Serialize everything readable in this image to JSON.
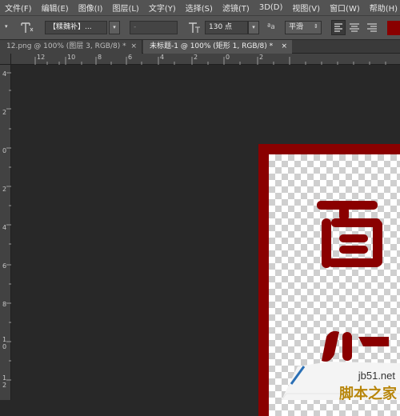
{
  "menu": [
    "文件(F)",
    "编辑(E)",
    "图像(I)",
    "图层(L)",
    "文字(Y)",
    "选择(S)",
    "滤镜(T)",
    "3D(D)",
    "视图(V)",
    "窗口(W)",
    "帮助(H)"
  ],
  "options": {
    "font_family": "【糅魏补】...",
    "font_style": "-",
    "font_size": "130 点",
    "aa_label": "ªa",
    "antialias": "平滑"
  },
  "tabs": [
    {
      "label": "12.png @ 100% (图层 3, RGB/8) *",
      "close": "×"
    },
    {
      "label": "未标题-1 @ 100% (矩形 1, RGB/8) *",
      "close": "×"
    }
  ],
  "ruler_h": [
    "12",
    "10",
    "8",
    "6",
    "4",
    "2",
    "0",
    "2"
  ],
  "ruler_v": [
    "4",
    "2",
    "0",
    "2",
    "4",
    "6",
    "8",
    "1",
    "0",
    "1",
    "2"
  ],
  "watermark": {
    "url": "jb51.net",
    "name": "脚本之家"
  },
  "colors": {
    "seal_red": "#8a0000",
    "ui_bg": "#535353",
    "canvas_bg": "#282828"
  }
}
